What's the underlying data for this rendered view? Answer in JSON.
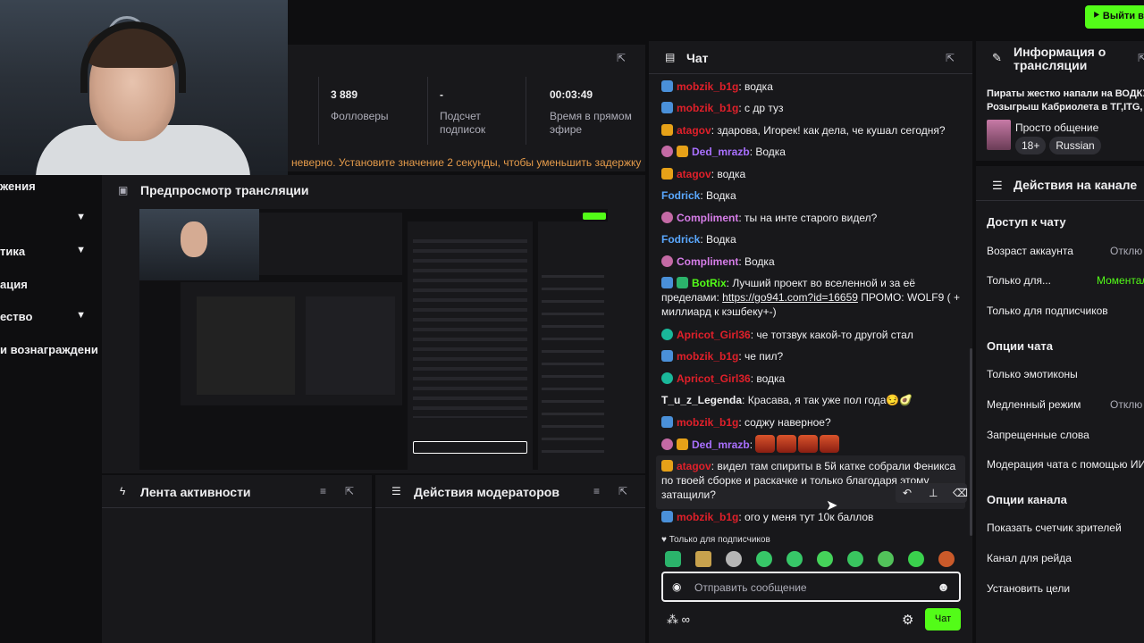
{
  "header": {
    "exit_label": "Выйти в"
  },
  "nav": {
    "items": [
      {
        "label": "жения",
        "chevron": false
      },
      {
        "label": "",
        "chevron": true
      },
      {
        "label": "тика",
        "chevron": true
      },
      {
        "label": "ация",
        "chevron": false
      },
      {
        "label": "ество",
        "chevron": true
      },
      {
        "label": "и вознаграждени",
        "chevron": false
      }
    ]
  },
  "stats": {
    "followers_value": "3 889",
    "followers_label": "Фолловеры",
    "subs_value": "-",
    "subs_label": "Подсчет подписок",
    "live_value": "00:03:49",
    "live_label": "Время в прямом эфире",
    "warning": "неверно. Установите значение 2 секунды, чтобы уменьшить задержку"
  },
  "preview": {
    "title": "Предпросмотр трансляции"
  },
  "activity": {
    "title": "Лента активности"
  },
  "mod_actions": {
    "title": "Действия модераторов"
  },
  "chat": {
    "title": "Чат",
    "messages": [
      {
        "badge": "mod",
        "user": "mobzik_b1g",
        "color": "#e0202a",
        "text": "водка"
      },
      {
        "badge": "mod",
        "user": "mobzik_b1g",
        "color": "#e0202a",
        "text": "с др туз"
      },
      {
        "badge": "gold",
        "user": "atagov",
        "color": "#e0202a",
        "text": "здарова, Игорек! как дела, че кушал сегодня?"
      },
      {
        "badge": "pink",
        "user": "Ded_mrazb",
        "color": "#a970ff",
        "text": "Водка"
      },
      {
        "badge": "gold",
        "user": "atagov",
        "color": "#e0202a",
        "text": "водка"
      },
      {
        "badge": "",
        "user": "Fodrick",
        "color": "#5aa8ff",
        "text": "Водка"
      },
      {
        "badge": "pink",
        "user": "Compliment",
        "color": "#d67de8",
        "text": "ты на инте старого видел?"
      },
      {
        "badge": "",
        "user": "Fodrick",
        "color": "#5aa8ff",
        "text": "Водка"
      },
      {
        "badge": "pink",
        "user": "Compliment",
        "color": "#d67de8",
        "text": "Водка"
      },
      {
        "badge": "mod",
        "user": "BotRix",
        "color": "#53fc18",
        "text": "Лучший проект во вселенной и за её пределами: ",
        "link": "https://go941.com?id=16659",
        "text2": " ПРОМО: WOLF9 ( + миллиард к кэшбеку+-)"
      },
      {
        "badge": "teal",
        "user": "Apricot_Girl36",
        "color": "#e0202a",
        "text": "че тотзвук какой-то другой стал"
      },
      {
        "badge": "mod",
        "user": "mobzik_b1g",
        "color": "#e0202a",
        "text": "че пил?"
      },
      {
        "badge": "teal",
        "user": "Apricot_Girl36",
        "color": "#e0202a",
        "text": "водка"
      },
      {
        "badge": "",
        "user": "T_u_z_Legenda",
        "color": "#efeff1",
        "text": "Красава, я так уже пол года😏🥑"
      },
      {
        "badge": "mod",
        "user": "mobzik_b1g",
        "color": "#e0202a",
        "text": "соджу наверное?"
      },
      {
        "badge": "pink",
        "user": "Ded_mrazb",
        "color": "#a970ff",
        "text": ""
      },
      {
        "badge": "gold",
        "user": "atagov",
        "color": "#e0202a",
        "text": "видел там спириты в 5й катке собрали Феникса по твоей сборке и раскачке и только благодаря этому затащили?"
      },
      {
        "badge": "mod",
        "user": "mobzik_b1g",
        "color": "#e0202a",
        "text": "ого у меня тут 10к баллов"
      }
    ],
    "subs_only": "Только для подписчиков",
    "input_placeholder": "Отправить сообщение",
    "send_label": "Чат"
  },
  "info": {
    "title": "Информация о трансляции",
    "stream_title": "Пираты жестко напали на ВОДКУ",
    "stream_title2": "Розыгрыш Кабриолета в ТГ,ITG,",
    "category": "Просто общение",
    "tags": [
      "18+",
      "Russian"
    ]
  },
  "channel_actions": {
    "title": "Действия на канале",
    "chat_access_title": "Доступ к чату",
    "account_age_label": "Возраст аккаунта",
    "account_age_value": "Отклю",
    "only_for_label": "Только для...",
    "only_for_value": "Моментал",
    "subscribers_only_label": "Только для подписчиков",
    "chat_options_title": "Опции чата",
    "emotes_only_label": "Только эмотиконы",
    "slow_mode_label": "Медленный режим",
    "slow_mode_value": "Отклю",
    "banned_words_label": "Запрещенные слова",
    "ai_moderation_label": "Модерация чата с помощью ИИ",
    "channel_options_title": "Опции канала",
    "viewer_count_label": "Показать счетчик зрителей",
    "raid_channel_label": "Канал для рейда",
    "set_goals_label": "Установить цели"
  }
}
